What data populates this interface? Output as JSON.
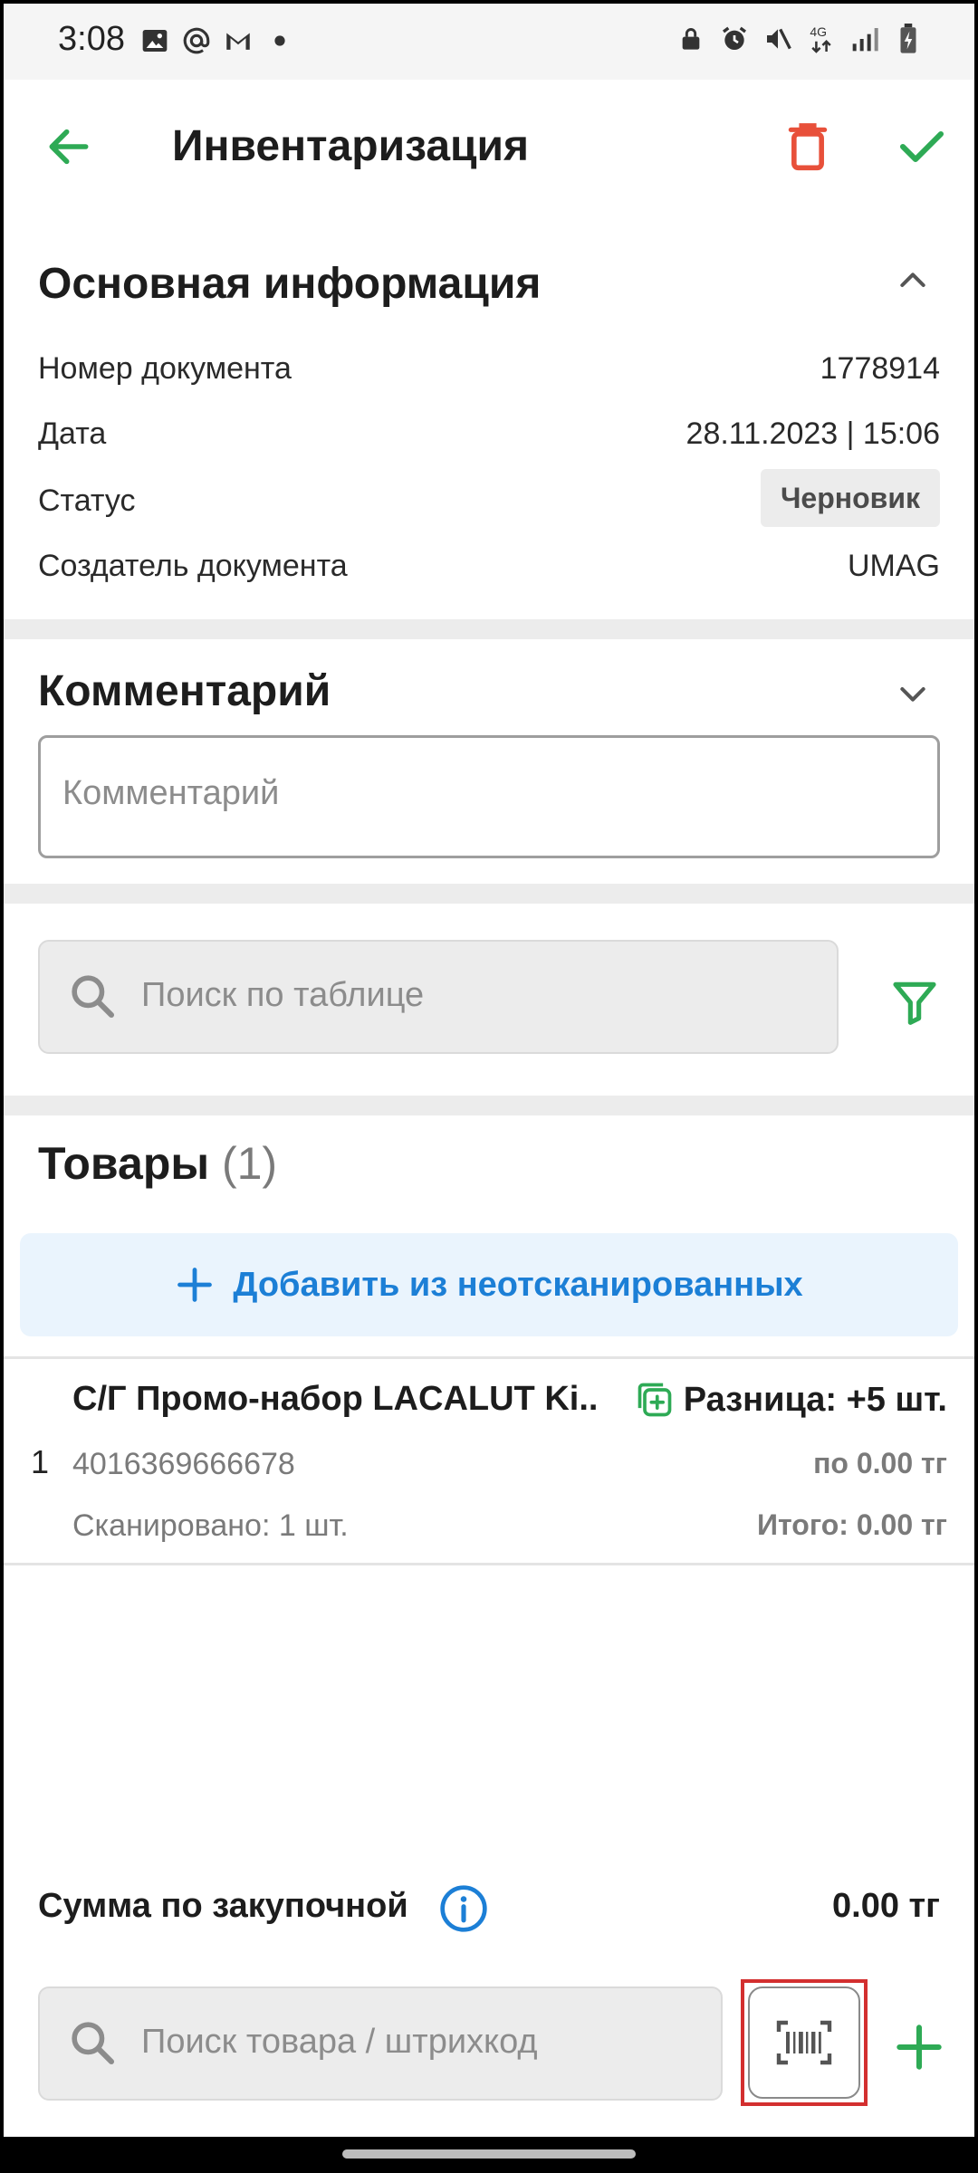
{
  "status_bar": {
    "time": "3:08",
    "left_icons": [
      "image-icon",
      "at-icon",
      "gmail-icon",
      "dot-icon"
    ],
    "right_icons": [
      "lock-icon",
      "alarm-icon",
      "mute-icon",
      "network-4g-icon",
      "signal-icon",
      "battery-icon"
    ],
    "network_label": "4G"
  },
  "appbar": {
    "title": "Инвентаризация",
    "back_icon": "arrow-back-icon",
    "delete_icon": "trash-icon",
    "confirm_icon": "check-icon"
  },
  "main_info": {
    "title": "Основная информация",
    "rows": [
      {
        "label": "Номер документа",
        "value": "1778914"
      },
      {
        "label": "Дата",
        "value": "28.11.2023 | 15:06"
      },
      {
        "label": "Статус",
        "value": "Черновик"
      },
      {
        "label": "Создатель документа",
        "value": "UMAG"
      }
    ]
  },
  "comment": {
    "title": "Комментарий",
    "placeholder": "Комментарий",
    "value": ""
  },
  "table_search": {
    "placeholder": "Поиск по таблице",
    "value": ""
  },
  "goods": {
    "title": "Товары",
    "count": "(1)",
    "add_button_label": "Добавить из неотсканированных",
    "items": [
      {
        "index": "1",
        "name": "С/Г Промо-набор LACALUT Ki..",
        "difference": "Разница: +5 шт.",
        "barcode": "4016369666678",
        "price": "по 0.00 тг",
        "scanned": "Сканировано: 1 шт.",
        "total": "Итого: 0.00 тг"
      }
    ]
  },
  "summary": {
    "label": "Сумма по закупочной",
    "value": "0.00 тг"
  },
  "bottom_search": {
    "placeholder": "Поиск товара / штрихкод",
    "value": ""
  },
  "colors": {
    "accent_green": "#2eaa55",
    "accent_blue": "#1c7fd6",
    "danger_red": "#e8503a",
    "highlight_red": "#d32f2f"
  }
}
